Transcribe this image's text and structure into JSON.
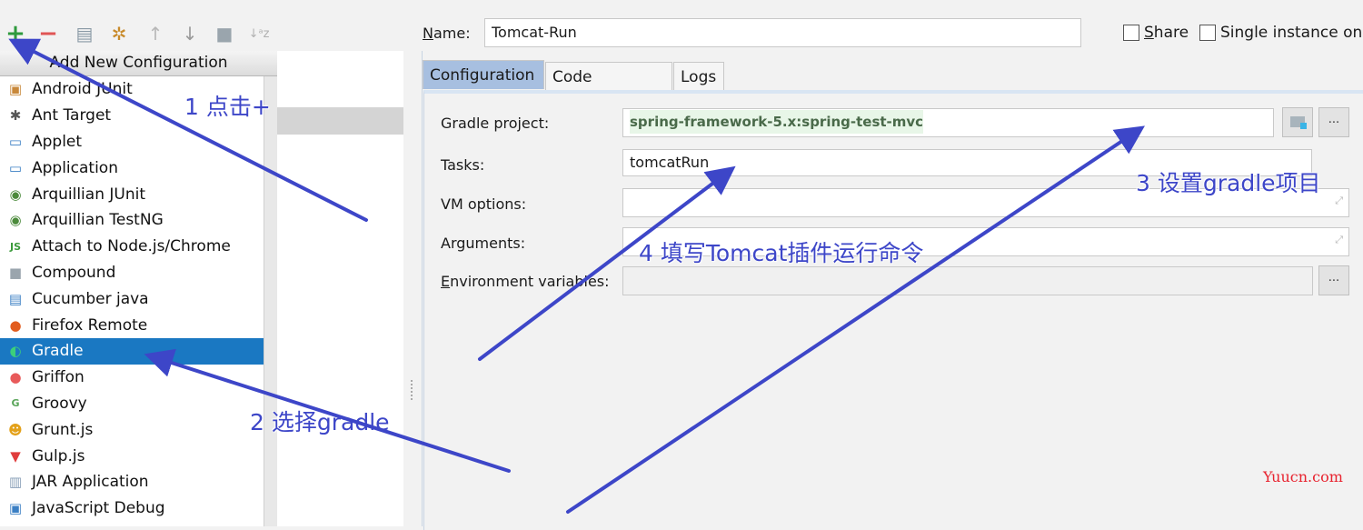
{
  "toolbar": {
    "buttons": [
      {
        "name": "add-icon",
        "glyph": "+",
        "color": "#2e9a3d"
      },
      {
        "name": "remove-icon",
        "glyph": "−",
        "color": "#e05555"
      },
      {
        "name": "copy-icon",
        "glyph": "▤",
        "color": "#8a9aa6"
      },
      {
        "name": "edit-defaults-icon",
        "glyph": "✲",
        "color": "#c88a2a"
      },
      {
        "name": "move-up-icon",
        "glyph": "↑",
        "color": "#b8b8b8"
      },
      {
        "name": "move-down-icon",
        "glyph": "↓",
        "color": "#9a9a9a"
      },
      {
        "name": "folder-icon",
        "glyph": "■",
        "color": "#9aa5ad"
      },
      {
        "name": "sort-icon",
        "glyph": "↓ᵃz",
        "color": "#b0b0b0"
      }
    ]
  },
  "popup": {
    "header": "Add New Configuration",
    "items": [
      {
        "label": "Android JUnit",
        "icon": "android-junit-icon",
        "glyph": "▣",
        "color": "#c8883a"
      },
      {
        "label": "Ant Target",
        "icon": "ant-icon",
        "glyph": "✱",
        "color": "#555"
      },
      {
        "label": "Applet",
        "icon": "applet-icon",
        "glyph": "▭",
        "color": "#3b7fc4"
      },
      {
        "label": "Application",
        "icon": "application-icon",
        "glyph": "▭",
        "color": "#3b7fc4"
      },
      {
        "label": "Arquillian JUnit",
        "icon": "arquillian-icon",
        "glyph": "◉",
        "color": "#4b8a3b"
      },
      {
        "label": "Arquillian TestNG",
        "icon": "arquillian-icon",
        "glyph": "◉",
        "color": "#4b8a3b"
      },
      {
        "label": "Attach to Node.js/Chrome",
        "icon": "nodejs-icon",
        "glyph": "JS",
        "color": "#3b9a3b"
      },
      {
        "label": "Compound",
        "icon": "compound-icon",
        "glyph": "■",
        "color": "#9aa5ad"
      },
      {
        "label": "Cucumber java",
        "icon": "cucumber-icon",
        "glyph": "▤",
        "color": "#3b7fc4"
      },
      {
        "label": "Firefox Remote",
        "icon": "firefox-icon",
        "glyph": "●",
        "color": "#e25d1f"
      },
      {
        "label": "Gradle",
        "icon": "gradle-icon",
        "glyph": "◐",
        "color": "#3ccf7a",
        "selected": true
      },
      {
        "label": "Griffon",
        "icon": "griffon-icon",
        "glyph": "●",
        "color": "#e85a5a"
      },
      {
        "label": "Groovy",
        "icon": "groovy-icon",
        "glyph": "G",
        "color": "#5aa55a"
      },
      {
        "label": "Grunt.js",
        "icon": "grunt-icon",
        "glyph": "☻",
        "color": "#e3a11a"
      },
      {
        "label": "Gulp.js",
        "icon": "gulp-icon",
        "glyph": "▼",
        "color": "#e03c3c"
      },
      {
        "label": "JAR Application",
        "icon": "jar-icon",
        "glyph": "▥",
        "color": "#8aa0b8"
      },
      {
        "label": "JavaScript Debug",
        "icon": "js-debug-icon",
        "glyph": "▣",
        "color": "#3b7fc4"
      }
    ]
  },
  "config": {
    "name_label": "Name:",
    "name_value": "Tomcat-Run",
    "share_label": "Share",
    "single_instance_label": "Single instance only",
    "tabs": [
      "Configuration",
      "Code Coverage",
      "Logs"
    ],
    "active_tab": "Configuration",
    "fields": {
      "gradle_project_label": "Gradle project:",
      "gradle_project_value": "spring-framework-5.x:spring-test-mvc",
      "tasks_label": "Tasks:",
      "tasks_value": "tomcatRun",
      "vm_options_label": "VM options:",
      "vm_options_value": "",
      "arguments_label": "Arguments:",
      "arguments_value": "",
      "env_label": "Environment variables:",
      "env_value": ""
    },
    "ellipsis": "..."
  },
  "annotations": {
    "step1": "1 点击+",
    "step2": "2 选择gradle",
    "step3": "3 设置gradle项目",
    "step4": "4 填写Tomcat插件运行命令",
    "arrow_color": "#3d46c8"
  },
  "watermark": "Yuucn.com"
}
